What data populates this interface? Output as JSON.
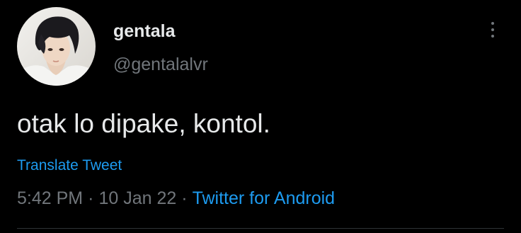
{
  "tweet": {
    "author": {
      "display_name": "gentala",
      "handle": "@gentalalvr",
      "avatar_icon": "profile-photo"
    },
    "text": "otak lo dipake, kontol.",
    "translate_label": "Translate Tweet",
    "time": "5:42 PM",
    "separator": "·",
    "date": "10 Jan 22",
    "source": "Twitter for Android",
    "more_icon": "more-vertical-icon"
  },
  "colors": {
    "background": "#000000",
    "primary_text": "#e7e9ea",
    "secondary_text": "#71767b",
    "link": "#1d9bf0",
    "divider": "#2f3336"
  }
}
